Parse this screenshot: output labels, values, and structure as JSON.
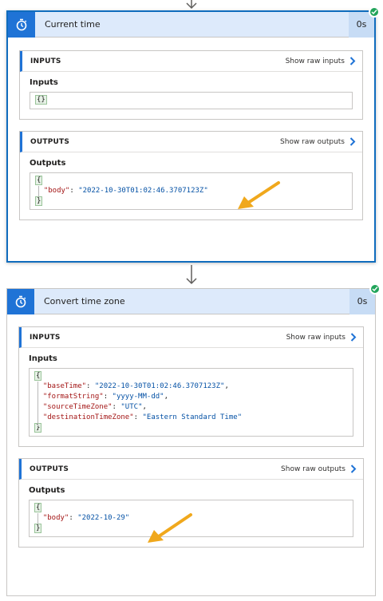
{
  "cards": [
    {
      "title": "Current time",
      "duration": "0s",
      "inputs": {
        "section_title": "INPUTS",
        "link": "Show raw inputs",
        "label": "Inputs",
        "empty_json": "{}"
      },
      "outputs": {
        "section_title": "OUTPUTS",
        "link": "Show raw outputs",
        "label": "Outputs",
        "key": "\"body\"",
        "value": "\"2022-10-30T01:02:46.3707123Z\""
      }
    },
    {
      "title": "Convert time zone",
      "duration": "0s",
      "inputs": {
        "section_title": "INPUTS",
        "link": "Show raw inputs",
        "label": "Inputs",
        "params": [
          {
            "key": "\"baseTime\"",
            "value": "\"2022-10-30T01:02:46.3707123Z\"",
            "sep": ","
          },
          {
            "key": "\"formatString\"",
            "value": "\"yyyy-MM-dd\"",
            "sep": ","
          },
          {
            "key": "\"sourceTimeZone\"",
            "value": "\"UTC\"",
            "sep": ","
          },
          {
            "key": "\"destinationTimeZone\"",
            "value": "\"Eastern Standard Time\"",
            "sep": ""
          }
        ]
      },
      "outputs": {
        "section_title": "OUTPUTS",
        "link": "Show raw outputs",
        "label": "Outputs",
        "key": "\"body\"",
        "value": "\"2022-10-29\""
      }
    }
  ],
  "colors": {
    "accent": "#1f73d6",
    "success": "#21a45a",
    "annotation_arrow": "#f0a81c"
  },
  "icons": [
    "timer-icon",
    "chevron-right-icon",
    "check-icon",
    "down-arrow-icon"
  ]
}
